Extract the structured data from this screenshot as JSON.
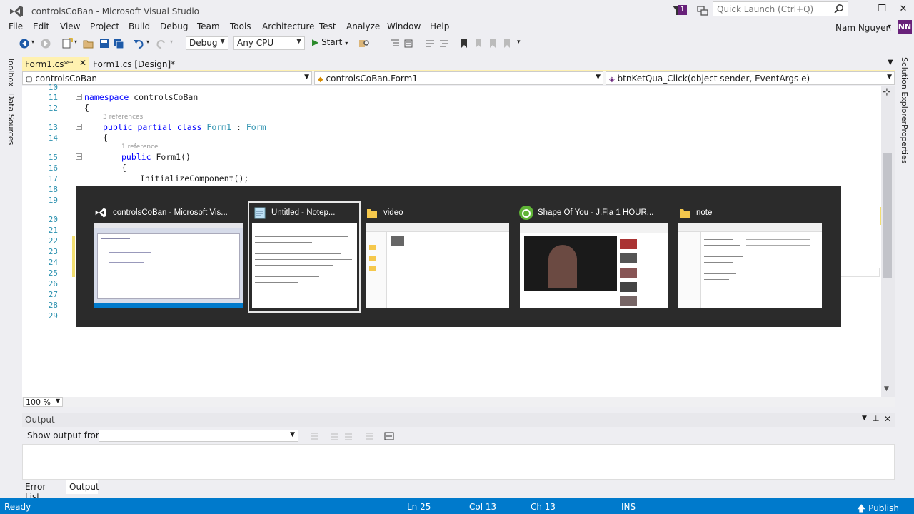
{
  "window": {
    "title": "controlsCoBan - Microsoft Visual Studio",
    "notification_count": "1",
    "quick_launch_placeholder": "Quick Launch (Ctrl+Q)",
    "user_name": "Nam Nguyen",
    "user_initials": "NN"
  },
  "menu": [
    "File",
    "Edit",
    "View",
    "Project",
    "Build",
    "Debug",
    "Team",
    "Tools",
    "Architecture",
    "Test",
    "Analyze",
    "Window",
    "Help"
  ],
  "toolbar": {
    "configuration": "Debug",
    "platform": "Any CPU",
    "start_label": "Start"
  },
  "side_tabs": {
    "left": [
      "Toolbox",
      "Data Sources"
    ],
    "right": [
      "Solution Explorer",
      "Properties"
    ]
  },
  "doc_tabs": {
    "active": "Form1.cs*",
    "inactive": "Form1.cs [Design]*"
  },
  "navbar": {
    "project": "controlsCoBan",
    "class": "controlsCoBan.Form1",
    "member": "btnKetQua_Click(object sender, EventArgs e)"
  },
  "editor": {
    "line_numbers": [
      "10",
      "11",
      "12",
      "13",
      "14",
      "15",
      "16",
      "17",
      "18",
      "19",
      "20",
      "21",
      "22",
      "23",
      "24",
      "25",
      "26",
      "27",
      "28",
      "29"
    ],
    "code": {
      "l11_kw": "namespace",
      "l11_name": " controlsCoBan",
      "l12": "{",
      "ref_3": "3 references",
      "l13_kw": "public partial class",
      "l13_name": " Form1",
      "l13_colon": " : ",
      "l13_base": "Form",
      "l14": "{",
      "ref_1": "1 reference",
      "l15_kw": "public",
      "l15_rest": " Form1()",
      "l16": "{",
      "l17": "InitializeComponent();",
      "l18": "}",
      "l28": "}"
    },
    "zoom": "100 %"
  },
  "task_switcher": {
    "items": [
      {
        "title": "controlsCoBan - Microsoft Vis...",
        "icon": "visual-studio-icon"
      },
      {
        "title": "Untitled - Notep...",
        "icon": "notepad-icon"
      },
      {
        "title": "video",
        "icon": "folder-icon"
      },
      {
        "title": "Shape Of You - J.Fla 1 HOUR...",
        "icon": "coccoc-browser-icon"
      },
      {
        "title": "note",
        "icon": "folder-icon"
      }
    ]
  },
  "output_panel": {
    "title": "Output",
    "show_from_label": "Show output from:"
  },
  "bottom_tabs": [
    "Error List...",
    "Output"
  ],
  "status": {
    "state": "Ready",
    "ln": "Ln 25",
    "col": "Col 13",
    "ch": "Ch 13",
    "mode": "INS",
    "publish": "Publish"
  },
  "colors": {
    "accent": "#007acc",
    "vs_purple": "#68217a",
    "active_tab": "#fff1b0",
    "switcher_bg": "#2b2b2b"
  }
}
